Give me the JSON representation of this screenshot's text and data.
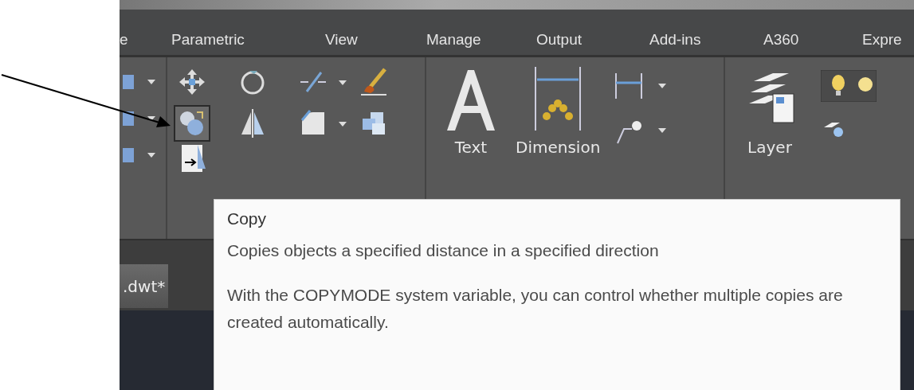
{
  "ribbon_tabs": [
    {
      "label": "e",
      "selected": false
    },
    {
      "label": "Parametric",
      "selected": false
    },
    {
      "label": "View",
      "selected": false
    },
    {
      "label": "Manage",
      "selected": false
    },
    {
      "label": "Output",
      "selected": false
    },
    {
      "label": "Add-ins",
      "selected": false
    },
    {
      "label": "A360",
      "selected": false
    },
    {
      "label": "Expre",
      "selected": false
    }
  ],
  "modify_tools": [
    {
      "kind": "move",
      "highlighted": false
    },
    {
      "kind": "rotate",
      "highlighted": false
    },
    {
      "kind": "trim",
      "highlighted": false
    },
    {
      "kind": "brush",
      "highlighted": false
    },
    {
      "kind": "copy",
      "highlighted": true
    },
    {
      "kind": "mirror",
      "highlighted": false
    },
    {
      "kind": "fillet",
      "highlighted": false
    },
    {
      "kind": "array",
      "highlighted": false
    }
  ],
  "large_tools": [
    {
      "kind": "text",
      "label": "Text"
    },
    {
      "kind": "dimension",
      "label": "Dimension"
    },
    {
      "kind": "layer",
      "label": "Layer"
    }
  ],
  "file_tab": {
    "label": ".dwt*"
  },
  "tooltip": {
    "title": "Copy",
    "description": "Copies objects a specified distance in a specified direction",
    "details": "With the COPYMODE system variable, you can control whether multiple copies are created automatically."
  }
}
